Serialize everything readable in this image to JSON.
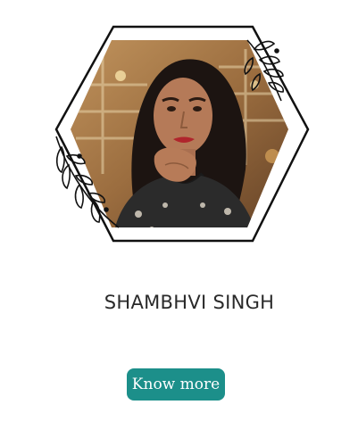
{
  "profile": {
    "name": "SHAMBHVI SINGH",
    "photo_icon": "portrait-photo",
    "frame_icon": "hexagon-frame",
    "decoration_icon": "leaf-branch-icon"
  },
  "actions": {
    "know_more_label": "Know more"
  },
  "colors": {
    "button_bg": "#1c8f8a",
    "button_text": "#ffffff",
    "name_text": "#2a2a2a",
    "frame_stroke": "#111111"
  }
}
